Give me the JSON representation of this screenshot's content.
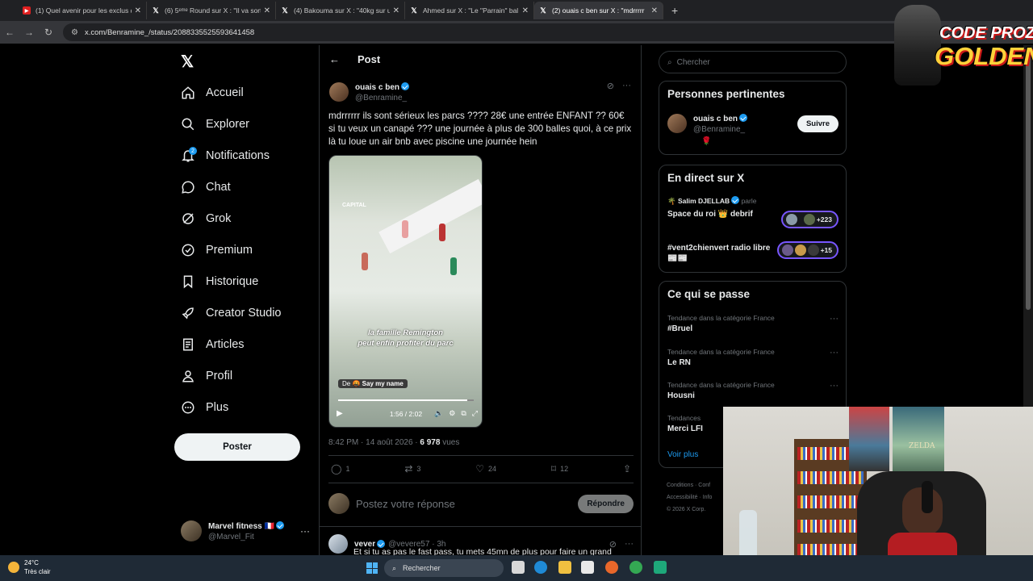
{
  "browser": {
    "tabs": [
      {
        "label": "(1) Quel avenir pour les exclus du",
        "icon": "youtube-icon",
        "active": false
      },
      {
        "label": "(6) 5ᵉᵐᵉ Round sur X : \"Il va sortir",
        "icon": "x-icon",
        "active": false
      },
      {
        "label": "(4) Bakouma sur X : \"40kg sur un",
        "icon": "x-icon",
        "active": false
      },
      {
        "label": "Ahmed sur X : \"Le \"Parrain\" bal",
        "icon": "x-icon",
        "active": false
      },
      {
        "label": "(2) ouais c ben sur X : \"mdrrrrr",
        "icon": "x-icon",
        "active": true
      }
    ],
    "url": "x.com/Benramine_/status/2088335525593641458"
  },
  "nav": {
    "logo": "𝕏",
    "notif_count": "2",
    "items": [
      {
        "label": "Accueil",
        "icon": "home-icon"
      },
      {
        "label": "Explorer",
        "icon": "search-icon"
      },
      {
        "label": "Notifications",
        "icon": "bell-icon"
      },
      {
        "label": "Chat",
        "icon": "chat-icon"
      },
      {
        "label": "Grok",
        "icon": "grok-icon"
      },
      {
        "label": "Premium",
        "icon": "premium-icon"
      },
      {
        "label": "Historique",
        "icon": "bookmark-icon"
      },
      {
        "label": "Creator Studio",
        "icon": "rocket-icon"
      },
      {
        "label": "Articles",
        "icon": "articles-icon"
      },
      {
        "label": "Profil",
        "icon": "profile-icon"
      },
      {
        "label": "Plus",
        "icon": "more-circle-icon"
      }
    ],
    "post_button": "Poster",
    "account": {
      "name": "Marvel fitness 🇫🇷",
      "handle": "@Marvel_Fit",
      "more": "···"
    }
  },
  "main": {
    "title": "Post",
    "author": {
      "name": "ouais c ben",
      "handle": "@Benramine_"
    },
    "text": "mdrrrrrr ils sont sérieux les parcs ???? 28€ une entrée ENFANT ?? 60€ si tu veux un canapé ??? une journée à plus de 300 balles quoi, à ce prix là tu loue un air bnb avec piscine une journée hein",
    "video": {
      "watermark": "CAPITAL",
      "caption_line1": "la famille Remington",
      "caption_line2": "peut enfin profiter du parc",
      "tag_prefix": "De 🤬",
      "tag_name": "Say my name",
      "time": "1:56 / 2:02",
      "progress": 0.95
    },
    "timestamp": "8:42 PM · 14 août 2026 · ",
    "views_count": "6 978",
    "views_label": " vues",
    "stats": {
      "replies": "1",
      "reposts": "3",
      "likes": "24",
      "bookmarks": "12"
    },
    "reply_placeholder": "Postez votre réponse",
    "reply_button": "Répondre",
    "reply2": {
      "name": "vever",
      "handle": "@vevere57 · 3h",
      "text": "Et si tu as pas le fast pass, tu mets 45mn de plus pour faire un grand"
    }
  },
  "right": {
    "search_placeholder": "Chercher",
    "relevant": {
      "title": "Personnes pertinentes",
      "name": "ouais c ben",
      "handle": "@Benramine_",
      "emoji": "🌹",
      "follow": "Suivre"
    },
    "live": {
      "title": "En direct sur X",
      "spaces": [
        {
          "speaker": "Salim DJELLAB",
          "speaker_suffix": " parle",
          "title": "Space du roi 👑 debrif",
          "count": "+223"
        },
        {
          "speaker": "",
          "speaker_suffix": "",
          "title": "#vent2chienvert radio libre 📰📰",
          "count": "+15"
        }
      ]
    },
    "trends": {
      "title": "Ce qui se passe",
      "items": [
        {
          "category": "Tendance dans la catégorie France",
          "name": "#Bruel"
        },
        {
          "category": "Tendance dans la catégorie France",
          "name": "Le RN"
        },
        {
          "category": "Tendance dans la catégorie France",
          "name": "Housni"
        },
        {
          "category": "Tendances",
          "name": "Merci LFI"
        }
      ],
      "see_more": "Voir plus"
    },
    "footer": {
      "line1": "Conditions · Conf",
      "line2": "Accessibilité · Info",
      "line3": "© 2026 X Corp."
    }
  },
  "overlay": {
    "line1": "CODE PROZIS",
    "line2": "GOLDENG"
  },
  "webcam": {
    "poster_text": "ZELDA"
  },
  "taskbar": {
    "temperature": "24°C",
    "weather": "Très clair",
    "search": "Rechercher"
  },
  "colors": {
    "accent": "#1d9bf0",
    "background": "#000000",
    "border": "#2f3336",
    "live": "#7856ff"
  }
}
